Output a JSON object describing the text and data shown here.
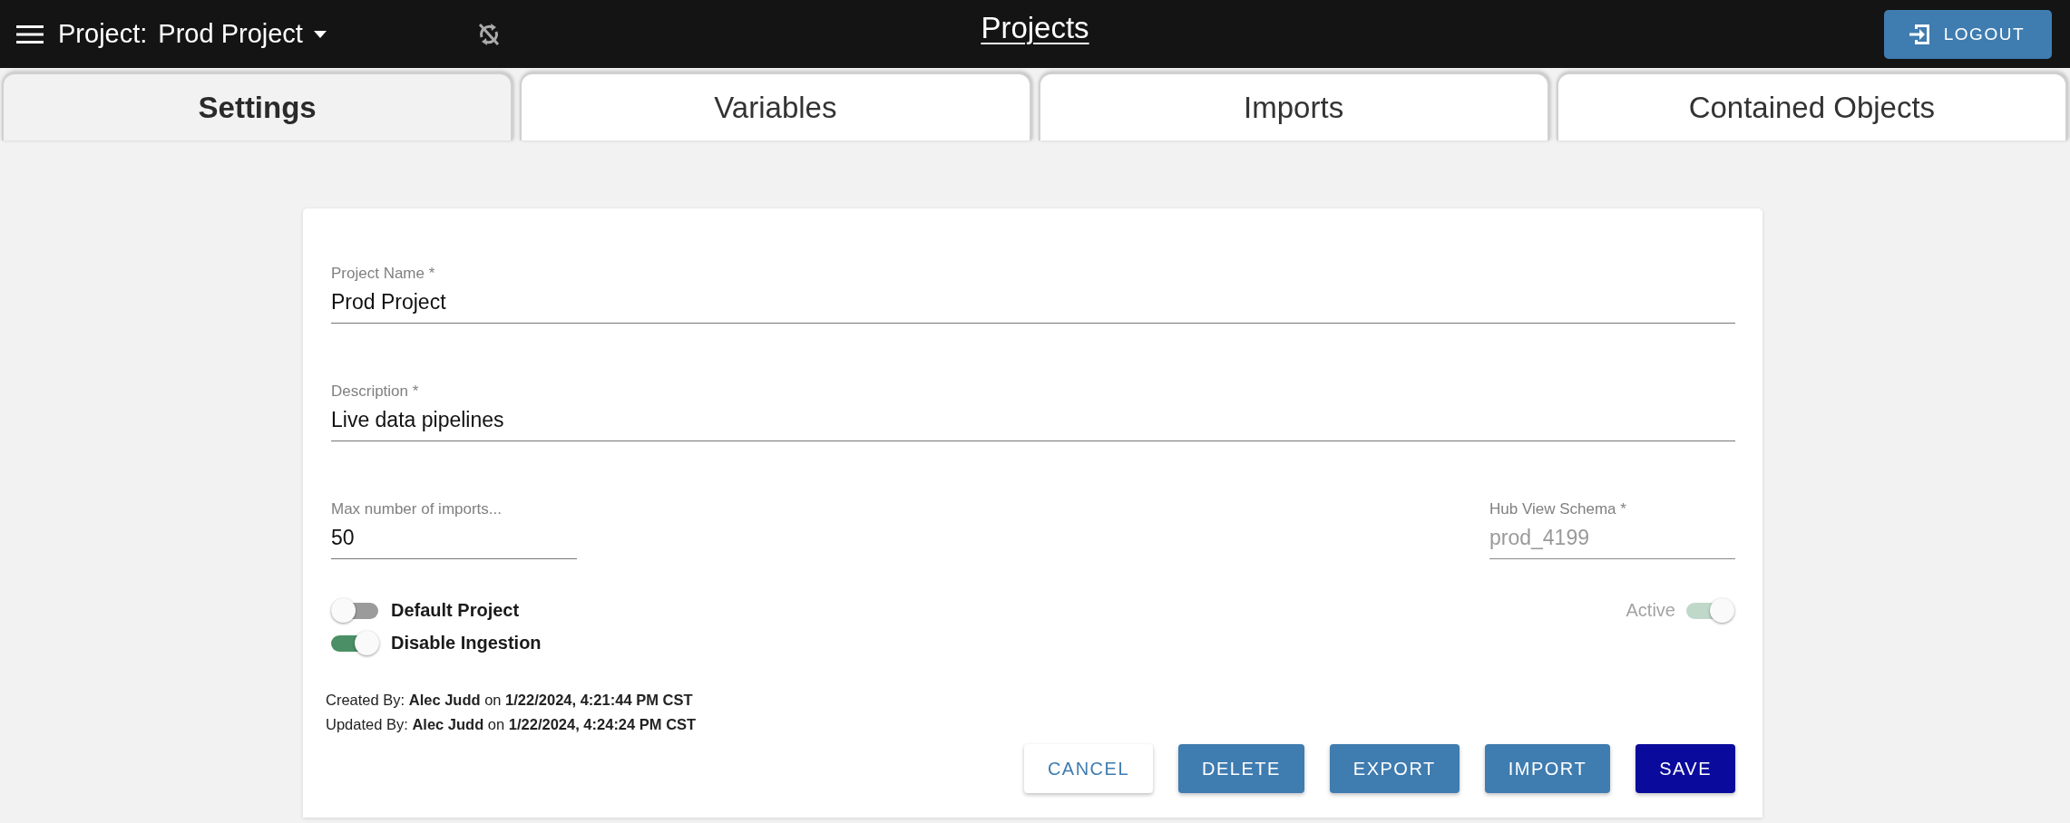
{
  "top_bar": {
    "project_label": "Project:",
    "project_name": "Prod Project",
    "page_title": "Projects",
    "logout_button": "LOGOUT"
  },
  "tabs": [
    {
      "label": "Settings",
      "selected": true
    },
    {
      "label": "Variables",
      "selected": false
    },
    {
      "label": "Imports",
      "selected": false
    },
    {
      "label": "Contained Objects",
      "selected": false
    }
  ],
  "form": {
    "fields": [
      {
        "label": "Project Name *",
        "value": "Prod Project",
        "disabled": false
      },
      {
        "label": "Description *",
        "value": "Live data pipelines",
        "disabled": false
      }
    ],
    "short_fields": [
      {
        "label": "Max number of imports...",
        "value": "50",
        "disabled": false
      },
      {
        "label": "Hub View Schema *",
        "value": "prod_4199",
        "disabled": true
      }
    ],
    "toggles": [
      {
        "label": "Default Project",
        "on": false,
        "disabled": false
      },
      {
        "label": "Disable Ingestion",
        "on": true,
        "disabled": false
      }
    ],
    "active_toggle": {
      "label": "Active",
      "on": true,
      "disabled": true
    },
    "audit": [
      "Created By: **Alec Judd** on **1/22/2024, 4:21:44 PM CST**",
      "Updated By: **Alec Judd** on **1/22/2024, 4:24:24 PM CST**"
    ],
    "buttons": [
      {
        "label": "CANCEL",
        "kind": "outlined"
      },
      {
        "label": "DELETE",
        "kind": "contained"
      },
      {
        "label": "EXPORT",
        "kind": "contained"
      },
      {
        "label": "IMPORT",
        "kind": "contained"
      },
      {
        "label": "SAVE",
        "kind": "primary"
      }
    ]
  }
}
